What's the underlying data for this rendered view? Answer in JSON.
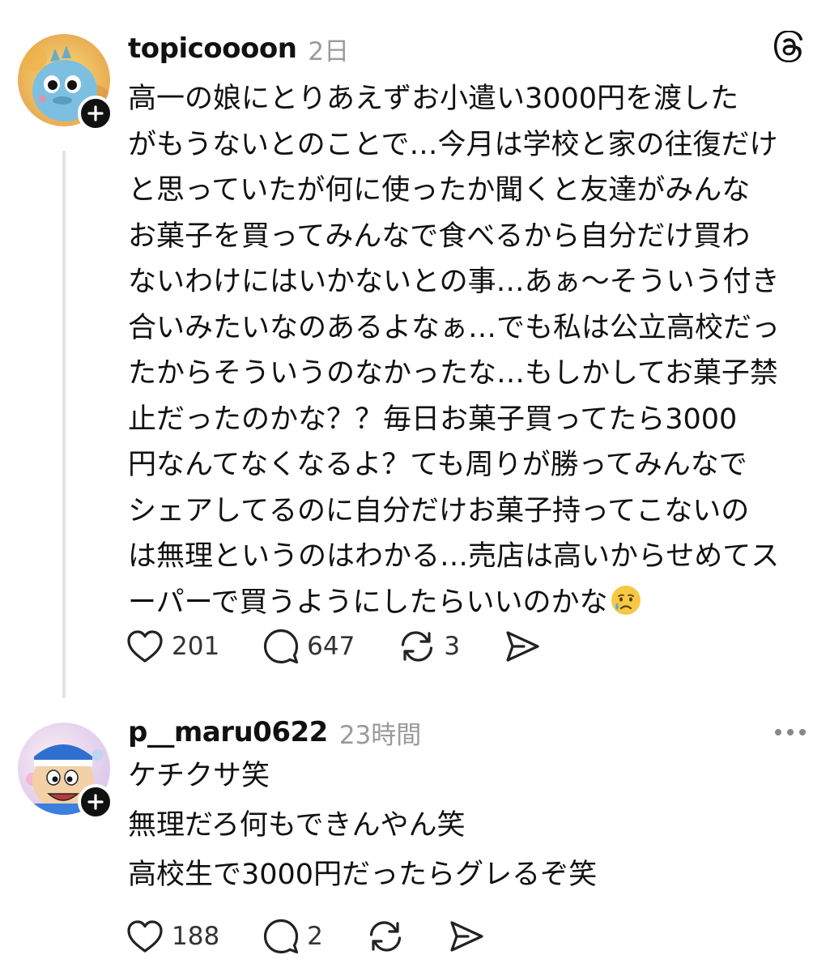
{
  "posts": [
    {
      "username": "topicoooon",
      "time": "2日",
      "app_icon": "threads-icon",
      "lines": [
        "高一の娘にとりあえずお小遣い3000円を渡した",
        "がもうないとのことで…今月は学校と家の往復だけ",
        "と思っていたが何に使ったか聞くと友達がみんな",
        "お菓子を買ってみんなで食べるから自分だけ買わ",
        "ないわけにはいかないとの事…あぁ〜そういう付き",
        "合いみたいなのあるよなぁ…でも私は公立高校だっ",
        "たからそういうのなかったな…もしかしてお菓子禁",
        "止だったのかな？？毎日お菓子買ってたら3000",
        "円なんてなくなるよ？ても周りが勝ってみんなで",
        "シェアしてるのに自分だけお菓子持ってこないの",
        "は無理というのはわかる…売店は高いからせめてス",
        "ーパーで買うようにしたらいいのかな"
      ],
      "trailing_emoji": "sad-relieved-face",
      "likes": "201",
      "replies": "647",
      "reposts": "3"
    },
    {
      "username": "p__maru0622",
      "time": "23時間",
      "lines": [
        "ケチクサ笑",
        "無理だろ何もできんやん笑",
        "高校生で3000円だったらグレるぞ笑"
      ],
      "likes": "188",
      "replies": "2",
      "reposts": ""
    }
  ],
  "colors": {
    "text": "#111111",
    "muted": "#9a9a9a",
    "thread_line": "#e3e3e3"
  }
}
